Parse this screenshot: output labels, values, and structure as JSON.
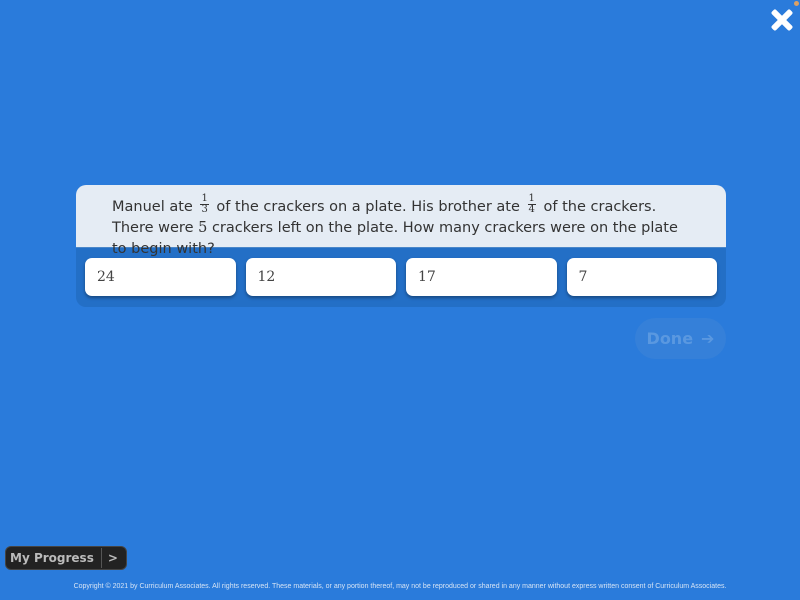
{
  "header": {
    "close_icon": "close-x-icon",
    "status_dot_color": "#d9a066"
  },
  "question": {
    "part1": "Manuel ate",
    "frac1": {
      "num": "1",
      "den": "3"
    },
    "part2": "of the crackers on a plate. His brother ate",
    "frac2": {
      "num": "1",
      "den": "4"
    },
    "part3": "of the crackers. There were",
    "number": "5",
    "part4": "crackers left on the plate. How many crackers were on the plate to begin with?"
  },
  "answers": [
    "24",
    "12",
    "17",
    "7"
  ],
  "done_button": {
    "label": "Done",
    "icon": "arrow-right-icon",
    "arrow": "➔",
    "enabled": false
  },
  "progress_button": {
    "label": "My Progress",
    "arrow": ">"
  },
  "footer": {
    "copyright": "Copyright © 2021 by Curriculum Associates. All rights reserved. These materials, or any portion thereof, may not be reproduced or shared in any manner without express written consent of Curriculum Associates."
  },
  "colors": {
    "background": "#2a7bdb",
    "question_bg": "#e5ecf4",
    "answer_bg": "#ffffff"
  }
}
